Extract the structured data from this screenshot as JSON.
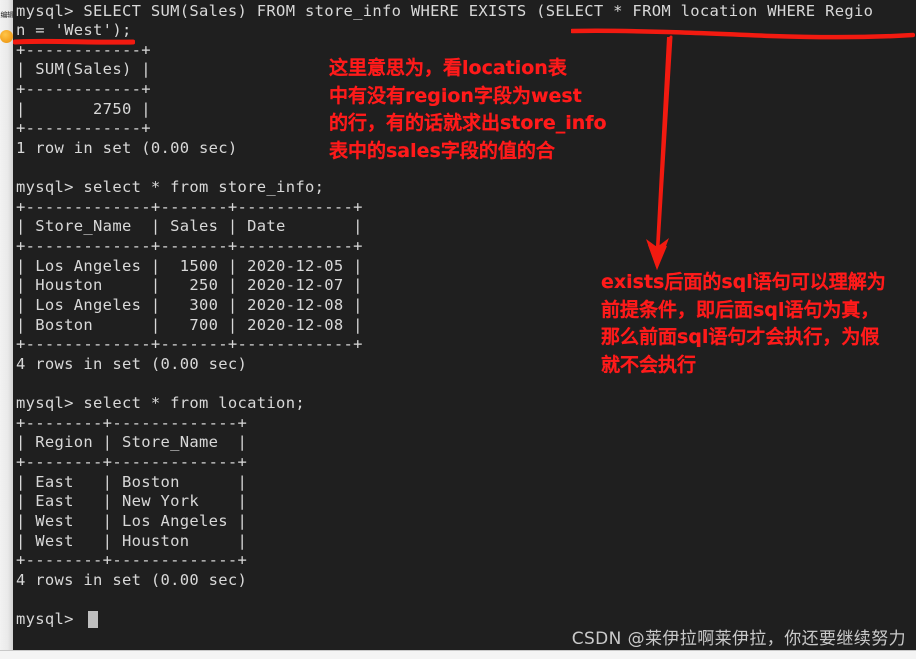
{
  "window": {
    "left_strip_label": "编辑",
    "background_color": "#1f1f1f",
    "text_color": "#d8d8d8",
    "annotation_color": "#ff1a1a"
  },
  "terminal": {
    "lines": [
      "mysql> SELECT SUM(Sales) FROM store_info WHERE EXISTS (SELECT * FROM location WHERE Regio",
      "n = 'West');",
      "+------------+",
      "| SUM(Sales) |",
      "+------------+",
      "|       2750 |",
      "+------------+",
      "1 row in set (0.00 sec)",
      "",
      "mysql> select * from store_info;",
      "+-------------+-------+------------+",
      "| Store_Name  | Sales | Date       |",
      "+-------------+-------+------------+",
      "| Los Angeles |  1500 | 2020-12-05 |",
      "| Houston     |   250 | 2020-12-07 |",
      "| Los Angeles |   300 | 2020-12-08 |",
      "| Boston      |   700 | 2020-12-08 |",
      "+-------------+-------+------------+",
      "4 rows in set (0.00 sec)",
      "",
      "mysql> select * from location;",
      "+--------+-------------+",
      "| Region | Store_Name  |",
      "+--------+-------------+",
      "| East   | Boston      |",
      "| East   | New York    |",
      "| West   | Los Angeles |",
      "| West   | Houston     |",
      "+--------+-------------+",
      "4 rows in set (0.00 sec)",
      "",
      "mysql> "
    ],
    "queries": [
      "SELECT SUM(Sales) FROM store_info WHERE EXISTS (SELECT * FROM location WHERE Region = 'West');",
      "select * from store_info;",
      "select * from location;"
    ],
    "results": [
      {
        "columns": [
          "SUM(Sales)"
        ],
        "rows": [
          [
            "2750"
          ]
        ],
        "status": "1 row in set (0.00 sec)"
      },
      {
        "columns": [
          "Store_Name",
          "Sales",
          "Date"
        ],
        "rows": [
          [
            "Los Angeles",
            "1500",
            "2020-12-05"
          ],
          [
            "Houston",
            "250",
            "2020-12-07"
          ],
          [
            "Los Angeles",
            "300",
            "2020-12-08"
          ],
          [
            "Boston",
            "700",
            "2020-12-08"
          ]
        ],
        "status": "4 rows in set (0.00 sec)"
      },
      {
        "columns": [
          "Region",
          "Store_Name"
        ],
        "rows": [
          [
            "East",
            "Boston"
          ],
          [
            "East",
            "New York"
          ],
          [
            "West",
            "Los Angeles"
          ],
          [
            "West",
            "Houston"
          ]
        ],
        "status": "4 rows in set (0.00 sec)"
      }
    ],
    "prompt": "mysql> "
  },
  "annotations": {
    "note_1": "这里意思为，看location表\n中有没有region字段为west\n的行，有的话就求出store_info\n表中的sales字段的值的合",
    "note_2": "exists后面的sql语句可以理解为\n前提条件，即后面sql语句为真，\n那么前面sql语句才会执行，为假\n就不会执行"
  },
  "watermark": {
    "text": "CSDN @莱伊拉啊莱伊拉，你还要继续努力"
  }
}
